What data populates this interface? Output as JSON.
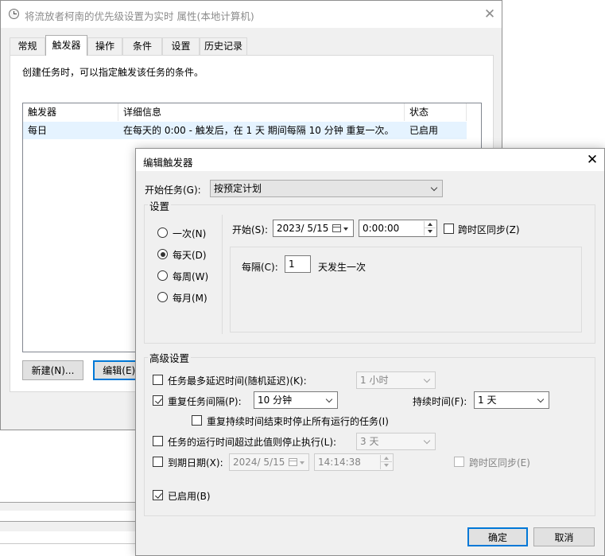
{
  "background_window": {
    "title": "将流放者柯南的优先级设置为实时 属性(本地计算机)",
    "tabs": [
      {
        "label": "常规"
      },
      {
        "label": "触发器",
        "active": true
      },
      {
        "label": "操作"
      },
      {
        "label": "条件"
      },
      {
        "label": "设置"
      },
      {
        "label": "历史记录"
      }
    ],
    "description": "创建任务时，可以指定触发该任务的条件。",
    "columns": [
      "触发器",
      "详细信息",
      "状态"
    ],
    "rows": [
      {
        "trigger": "每日",
        "details": "在每天的 0:00 - 触发后，在 1 天 期间每隔 10 分钟 重复一次。",
        "status": "已启用"
      }
    ],
    "buttons": {
      "new": "新建(N)...",
      "edit": "编辑(E)..."
    }
  },
  "dialog": {
    "title": "编辑触发器",
    "start_task_label": "开始任务(G):",
    "start_task_value": "按预定计划",
    "settings_group": "设置",
    "frequency": [
      {
        "label": "一次(N)",
        "selected": false
      },
      {
        "label": "每天(D)",
        "selected": true
      },
      {
        "label": "每周(W)",
        "selected": false
      },
      {
        "label": "每月(M)",
        "selected": false
      }
    ],
    "start_label": "开始(S):",
    "start_date": "2023/  5/15",
    "start_time": "0:00:00",
    "sync_timezone": {
      "label": "跨时区同步(Z)",
      "checked": false
    },
    "recur_label": "每隔(C):",
    "recur_value": "1",
    "recur_suffix": "天发生一次",
    "advanced_group": "高级设置",
    "delay": {
      "label": "任务最多延迟时间(随机延迟)(K):",
      "checked": false,
      "value": "1 小时"
    },
    "repeat": {
      "label": "重复任务间隔(P):",
      "checked": true,
      "value": "10 分钟"
    },
    "duration": {
      "label": "持续时间(F):",
      "value": "1 天"
    },
    "stop_running": {
      "label": "重复持续时间结束时停止所有运行的任务(I)",
      "checked": false
    },
    "stop_if_longer": {
      "label": "任务的运行时间超过此值则停止执行(L):",
      "checked": false,
      "value": "3 天"
    },
    "expire": {
      "label": "到期日期(X):",
      "checked": false,
      "date": "2024/  5/15",
      "time": "14:14:38"
    },
    "expire_sync": {
      "label": "跨时区同步(E)",
      "checked": false
    },
    "enabled": {
      "label": "已启用(B)",
      "checked": true
    },
    "ok": "确定",
    "cancel": "取消"
  },
  "colors": {
    "accent": "#0078d7",
    "selection": "#e5f3ff",
    "dialog_bg": "#f0f0f0"
  }
}
